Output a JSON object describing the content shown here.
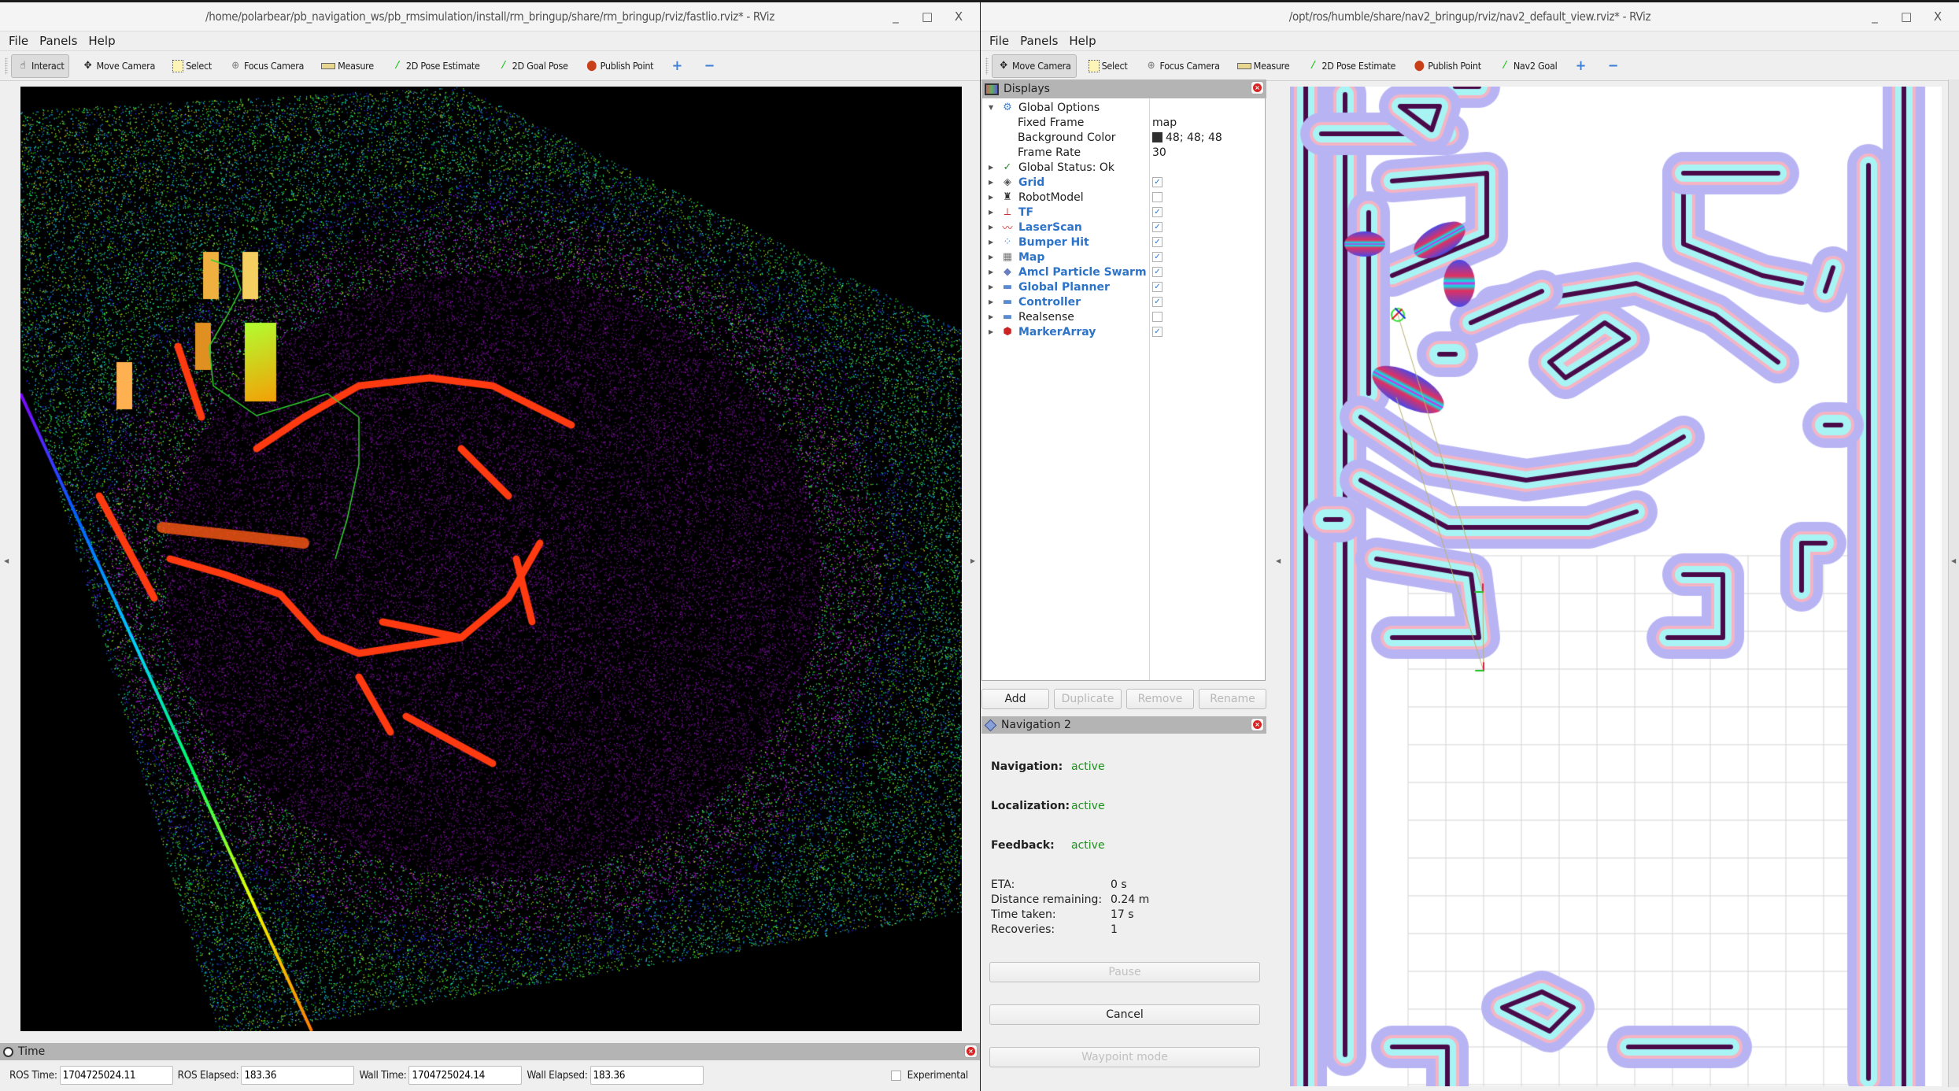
{
  "left_window": {
    "title": "/home/polarbear/pb_navigation_ws/pb_rmsimulation/install/rm_bringup/share/rm_bringup/rviz/fastlio.rviz* - RViz",
    "window_controls": [
      "_",
      "□",
      "X"
    ],
    "menu": [
      "File",
      "Panels",
      "Help"
    ],
    "toolbar": [
      {
        "label": "Interact",
        "icon": "hand-pointer-icon",
        "active": true
      },
      {
        "label": "Move Camera",
        "icon": "move-camera-icon",
        "active": false
      },
      {
        "label": "Select",
        "icon": "select-box-icon",
        "active": false
      },
      {
        "label": "Focus Camera",
        "icon": "focus-camera-icon",
        "active": false
      },
      {
        "label": "Measure",
        "icon": "ruler-icon",
        "active": false
      },
      {
        "label": "2D Pose Estimate",
        "icon": "green-arrow-icon",
        "active": false
      },
      {
        "label": "2D Goal Pose",
        "icon": "green-arrow-icon",
        "active": false
      },
      {
        "label": "Publish Point",
        "icon": "map-pin-icon",
        "active": false
      }
    ],
    "toolbar_extra": {
      "plus": "+",
      "minus": "−"
    },
    "viewport": {
      "type": "3d-point-cloud",
      "description": "FAST-LIO point cloud map with green path"
    },
    "time_panel": {
      "title": "Time",
      "ros_time_label": "ROS Time:",
      "ros_time": "1704725024.11",
      "ros_elapsed_label": "ROS Elapsed:",
      "ros_elapsed": "183.36",
      "wall_time_label": "Wall Time:",
      "wall_time": "1704725024.14",
      "wall_elapsed_label": "Wall Elapsed:",
      "wall_elapsed": "183.36",
      "experimental_label": "Experimental",
      "experimental_checked": false
    }
  },
  "right_window": {
    "title": "/opt/ros/humble/share/nav2_bringup/rviz/nav2_default_view.rviz* - RViz",
    "window_controls": [
      "_",
      "□",
      "X"
    ],
    "menu": [
      "File",
      "Panels",
      "Help"
    ],
    "toolbar": [
      {
        "label": "Move Camera",
        "icon": "move-camera-icon",
        "active": true
      },
      {
        "label": "Select",
        "icon": "select-box-icon",
        "active": false
      },
      {
        "label": "Focus Camera",
        "icon": "focus-camera-icon",
        "active": false
      },
      {
        "label": "Measure",
        "icon": "ruler-icon",
        "active": false
      },
      {
        "label": "2D Pose Estimate",
        "icon": "green-arrow-icon",
        "active": false
      },
      {
        "label": "Publish Point",
        "icon": "map-pin-icon",
        "active": false
      },
      {
        "label": "Nav2 Goal",
        "icon": "green-arrow-icon",
        "active": false
      }
    ],
    "toolbar_extra": {
      "plus": "+",
      "minus": "−"
    },
    "displays": {
      "title": "Displays",
      "global_options": {
        "label": "Global Options",
        "fixed_frame_label": "Fixed Frame",
        "fixed_frame": "map",
        "background_color_label": "Background Color",
        "background_color": "48; 48; 48",
        "background_swatch": "#303030",
        "frame_rate_label": "Frame Rate",
        "frame_rate": "30"
      },
      "global_status": "Global Status: Ok",
      "items": [
        {
          "label": "Grid",
          "icon": "grid-icon",
          "checked": true
        },
        {
          "label": "RobotModel",
          "icon": "robot-model-icon",
          "checked": false
        },
        {
          "label": "TF",
          "icon": "tf-axes-icon",
          "checked": true
        },
        {
          "label": "LaserScan",
          "icon": "laser-scan-icon",
          "checked": true
        },
        {
          "label": "Bumper Hit",
          "icon": "point-cloud-icon",
          "checked": true
        },
        {
          "label": "Map",
          "icon": "map-grid-icon",
          "checked": true
        },
        {
          "label": "Amcl Particle Swarm",
          "icon": "diamond-icon",
          "checked": true
        },
        {
          "label": "Global Planner",
          "icon": "folder-icon",
          "checked": true
        },
        {
          "label": "Controller",
          "icon": "folder-icon",
          "checked": true
        },
        {
          "label": "Realsense",
          "icon": "folder-icon",
          "checked": false
        },
        {
          "label": "MarkerArray",
          "icon": "marker-array-icon",
          "checked": true
        }
      ],
      "buttons": {
        "add": "Add",
        "duplicate": "Duplicate",
        "remove": "Remove",
        "rename": "Rename"
      }
    },
    "navigation2": {
      "title": "Navigation 2",
      "navigation_label": "Navigation:",
      "navigation_status": "active",
      "localization_label": "Localization:",
      "localization_status": "active",
      "feedback_label": "Feedback:",
      "feedback_status": "active",
      "stats": [
        {
          "label": "ETA:",
          "value": "0 s"
        },
        {
          "label": "Distance remaining:",
          "value": "0.24 m"
        },
        {
          "label": "Time taken:",
          "value": "17 s"
        },
        {
          "label": "Recoveries:",
          "value": "1"
        }
      ],
      "pause_label": "Pause",
      "cancel_label": "Cancel",
      "waypoint_label": "Waypoint mode",
      "status_color": "#1d8f1d"
    },
    "map_view": {
      "type": "costmap-2d",
      "colors": {
        "wall": "#4a0a4a",
        "inflation": "#b8b4f4",
        "lethal": "#a8f4f4",
        "gradient": "#f4b4c4"
      }
    }
  }
}
